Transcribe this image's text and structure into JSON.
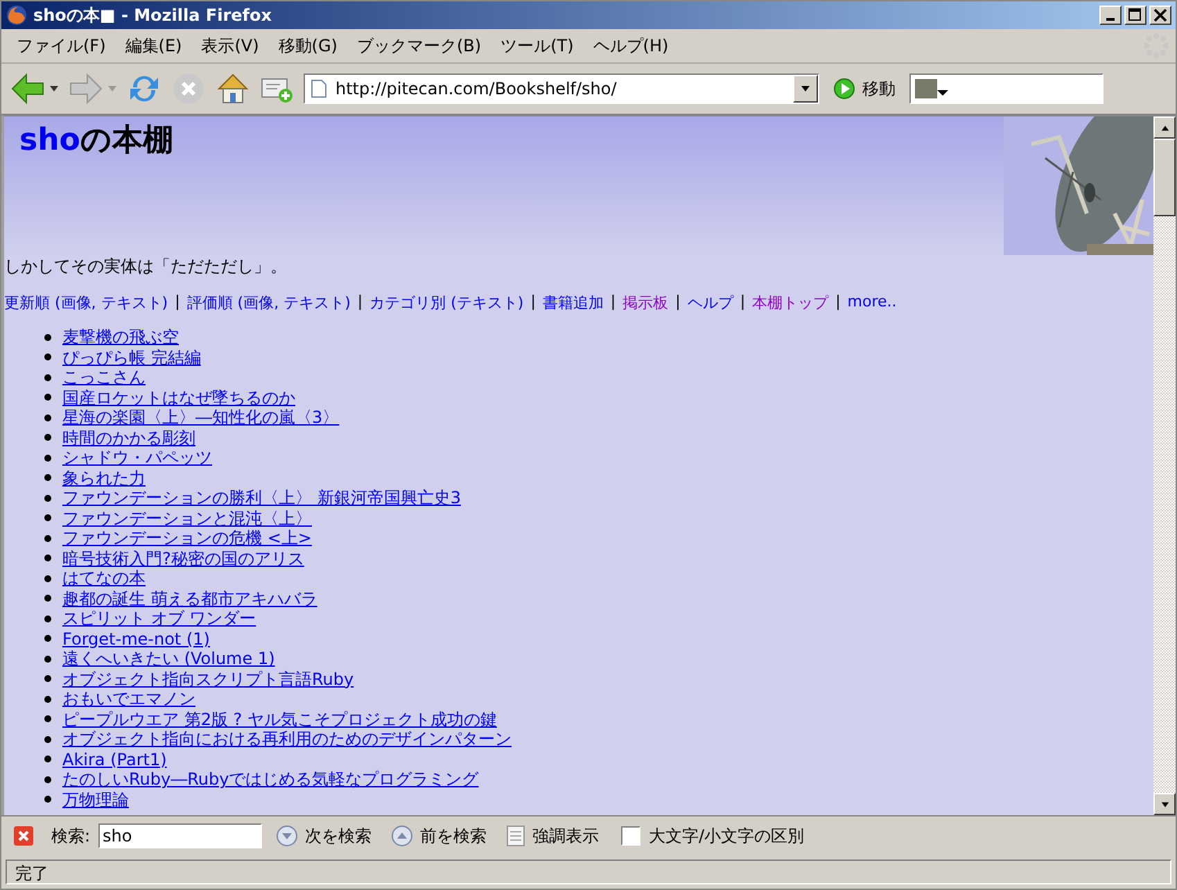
{
  "window": {
    "title": "shoの本■ - Mozilla Firefox"
  },
  "menu": [
    "ファイル(F)",
    "編集(E)",
    "表示(V)",
    "移動(G)",
    "ブックマーク(B)",
    "ツール(T)",
    "ヘルプ(H)"
  ],
  "toolbar": {
    "url": "http://pitecan.com/Bookshelf/sho/",
    "go_label": "移動"
  },
  "page": {
    "heading_link": "sho",
    "heading_text": "の本棚",
    "tagline": "しかしてその実体は「ただただし」。",
    "separator": "|",
    "nav": [
      {
        "label": "更新順 (画像, テキスト)",
        "visited": false
      },
      {
        "label": "評価順 (画像, テキスト)",
        "visited": false
      },
      {
        "label": "カテゴリ別 (テキスト)",
        "visited": false
      },
      {
        "label": "書籍追加",
        "visited": false
      },
      {
        "label": "掲示板",
        "visited": true
      },
      {
        "label": "ヘルプ",
        "visited": false
      },
      {
        "label": "本棚トップ",
        "visited": true
      },
      {
        "label": "more..",
        "visited": false
      }
    ],
    "books": [
      "麦撃機の飛ぶ空",
      "ぴっぴら帳 完結編",
      "こっこさん",
      "国産ロケットはなぜ墜ちるのか",
      "星海の楽園〈上〉―知性化の嵐〈3〉",
      "時間のかかる彫刻",
      "シャドウ・パペッツ",
      "象られた力",
      "ファウンデーションの勝利〈上〉 新銀河帝国興亡史3",
      "ファウンデーションと混沌〈上〉",
      "ファウンデーションの危機 <上>",
      "暗号技術入門?秘密の国のアリス",
      "はてなの本",
      "趣都の誕生 萌える都市アキハバラ",
      "スピリット オブ ワンダー",
      "Forget-me-not (1)",
      "遠くへいきたい (Volume 1)",
      "オブジェクト指向スクリプト言語Ruby",
      "おもいでエマノン",
      "ピープルウエア 第2版 ? ヤル気こそプロジェクト成功の鍵",
      "オブジェクト指向における再利用のためのデザインパターン",
      "Akira (Part1)",
      "たのしいRuby―Rubyではじめる気軽なプログラミング",
      "万物理論"
    ]
  },
  "findbar": {
    "label": "検索:",
    "value": "sho",
    "next": "次を検索",
    "prev": "前を検索",
    "highlight": "強調表示",
    "match_case": {
      "label": "大文字/小文字の区別",
      "checked": false
    }
  },
  "status_bar": "完了"
}
